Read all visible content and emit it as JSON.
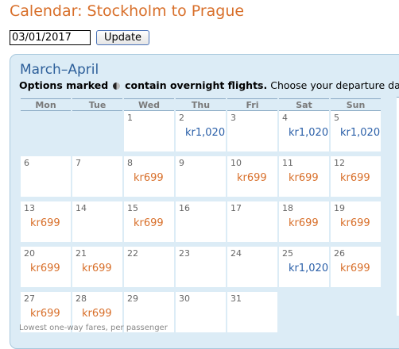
{
  "page": {
    "title": "Calendar: Stockholm to Prague"
  },
  "controls": {
    "date_value": "03/01/2017",
    "update_label": "Update"
  },
  "calendar": {
    "month_title": "March–April",
    "options_bold": "Options marked",
    "options_bold2": "contain overnight flights.",
    "options_rest": " Choose your departure date.",
    "weekdays": [
      "Mon",
      "Tue",
      "Wed",
      "Thu",
      "Fri",
      "Sat",
      "Sun"
    ],
    "weeks": [
      [
        {
          "day": "",
          "price": "",
          "color": ""
        },
        {
          "day": "",
          "price": "",
          "color": ""
        },
        {
          "day": "1",
          "price": "",
          "color": ""
        },
        {
          "day": "2",
          "price": "kr1,020",
          "color": "blue"
        },
        {
          "day": "3",
          "price": "",
          "color": ""
        },
        {
          "day": "4",
          "price": "kr1,020",
          "color": "blue"
        },
        {
          "day": "5",
          "price": "kr1,020",
          "color": "blue"
        }
      ],
      [
        {
          "day": "6",
          "price": "",
          "color": ""
        },
        {
          "day": "7",
          "price": "",
          "color": ""
        },
        {
          "day": "8",
          "price": "kr699",
          "color": "orange"
        },
        {
          "day": "9",
          "price": "",
          "color": ""
        },
        {
          "day": "10",
          "price": "kr699",
          "color": "orange"
        },
        {
          "day": "11",
          "price": "kr699",
          "color": "orange"
        },
        {
          "day": "12",
          "price": "kr699",
          "color": "orange"
        }
      ],
      [
        {
          "day": "13",
          "price": "kr699",
          "color": "orange"
        },
        {
          "day": "14",
          "price": "",
          "color": ""
        },
        {
          "day": "15",
          "price": "kr699",
          "color": "orange"
        },
        {
          "day": "16",
          "price": "",
          "color": ""
        },
        {
          "day": "17",
          "price": "",
          "color": ""
        },
        {
          "day": "18",
          "price": "kr699",
          "color": "orange"
        },
        {
          "day": "19",
          "price": "kr699",
          "color": "orange"
        }
      ],
      [
        {
          "day": "20",
          "price": "kr699",
          "color": "orange"
        },
        {
          "day": "21",
          "price": "kr699",
          "color": "orange"
        },
        {
          "day": "22",
          "price": "",
          "color": ""
        },
        {
          "day": "23",
          "price": "",
          "color": ""
        },
        {
          "day": "24",
          "price": "",
          "color": ""
        },
        {
          "day": "25",
          "price": "kr1,020",
          "color": "blue"
        },
        {
          "day": "26",
          "price": "kr699",
          "color": "orange"
        }
      ],
      [
        {
          "day": "27",
          "price": "kr699",
          "color": "orange"
        },
        {
          "day": "28",
          "price": "kr699",
          "color": "orange"
        },
        {
          "day": "29",
          "price": "",
          "color": ""
        },
        {
          "day": "30",
          "price": "",
          "color": ""
        },
        {
          "day": "31",
          "price": "",
          "color": ""
        },
        {
          "day": "",
          "price": "",
          "color": ""
        },
        {
          "day": "",
          "price": "",
          "color": ""
        }
      ]
    ],
    "footnote": "Lowest one-way fares, per passenger"
  },
  "colors": {
    "orange": "#d86f2a",
    "blue": "#2a5fa8",
    "panel_bg": "#dcecf6"
  },
  "icons": {
    "overnight": "moon-icon"
  }
}
